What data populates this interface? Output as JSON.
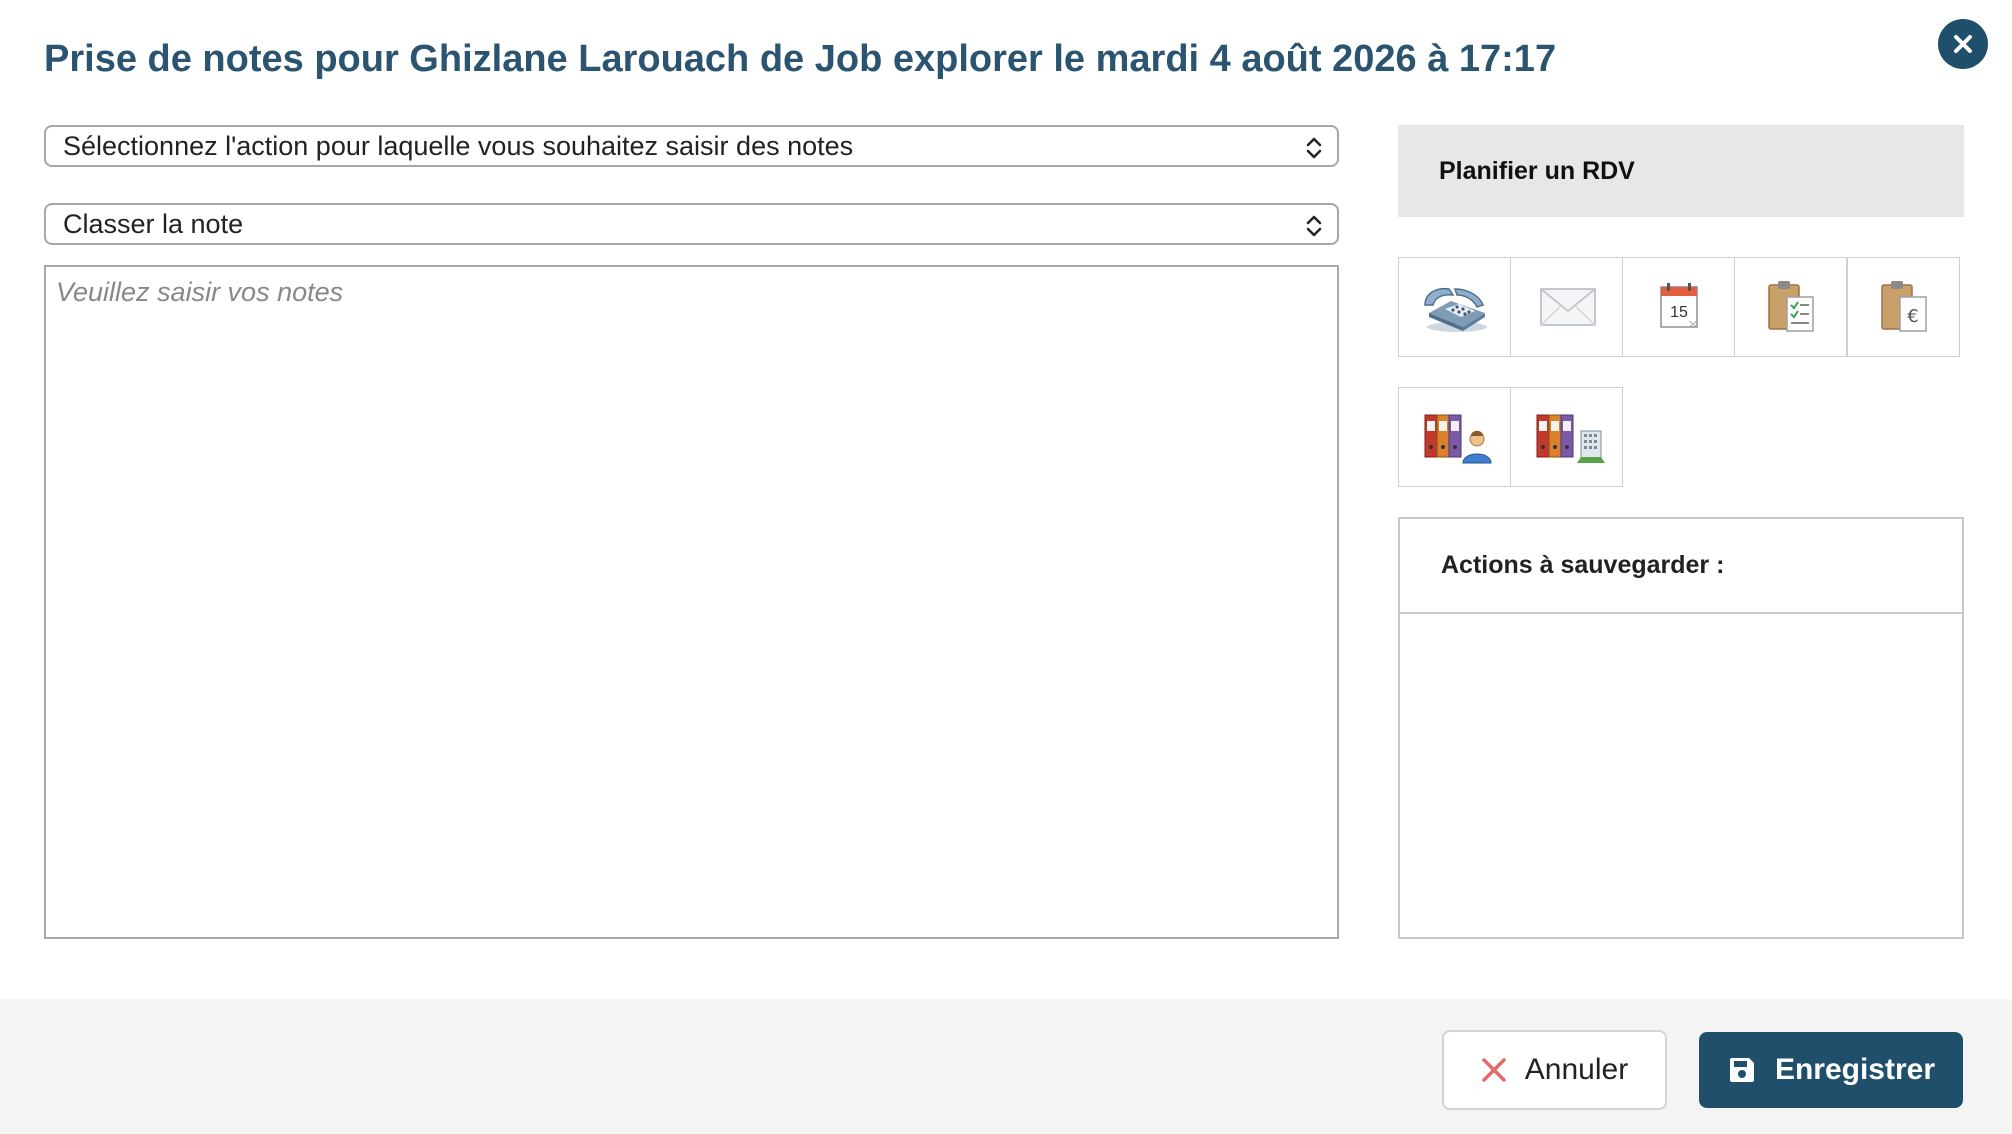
{
  "dialog": {
    "title": "Prise de notes pour Ghizlane Larouach de Job explorer le mardi 4 août 2026 à 17:17"
  },
  "form": {
    "action_select": {
      "value": "Sélectionnez l'action pour laquelle vous souhaitez saisir des notes"
    },
    "class_select": {
      "value": "Classer la note"
    },
    "notes": {
      "placeholder": "Veuillez saisir vos notes",
      "value": ""
    }
  },
  "side": {
    "plan_header": "Planifier un RDV",
    "action_icons": [
      "telephone-icon",
      "envelope-icon",
      "calendar-icon",
      "clipboard-checklist-icon",
      "clipboard-euro-icon",
      "binders-person-icon",
      "binders-building-icon"
    ],
    "calendar_day": "15",
    "save_panel_title": "Actions à sauvegarder :"
  },
  "footer": {
    "cancel_label": "Annuler",
    "save_label": "Enregistrer"
  },
  "colors": {
    "primary": "#204f6b",
    "title": "#2b5470",
    "cancel_icon": "#e36a6a",
    "footer_bg": "#f4f4f4",
    "panel_header_bg": "#e6e8e7"
  }
}
